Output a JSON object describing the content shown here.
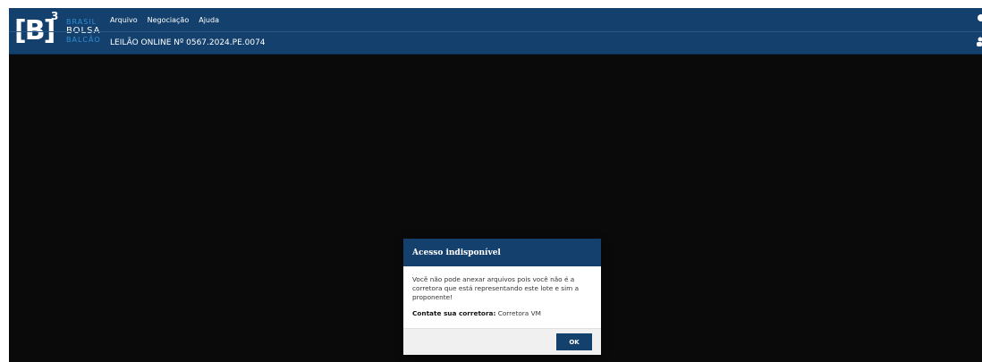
{
  "logo": {
    "mark": "[B]",
    "superscript": "3",
    "line1": "BRASIL",
    "line2": "BOLSA",
    "line3": "BALCÃO"
  },
  "menu": {
    "items": [
      "Arquivo",
      "Negociação",
      "Ajuda"
    ]
  },
  "header": {
    "auction_title": "LEILÃO ONLINE Nº 0567.2024.PE.0074"
  },
  "icons": {
    "help": "help-icon",
    "user": "user-icon"
  },
  "modal": {
    "title": "Acesso indisponível",
    "message": "Você não pode anexar arquivos pois você não é a corretora que está representando este lote e sim a proponente!",
    "contact_label": "Contate sua corretora:",
    "contact_value": "Corretora VM",
    "ok_label": "OK"
  },
  "colors": {
    "brand_navy": "#14406d",
    "accent_blue": "#2e8fd6",
    "overlay": "#0a0a0a"
  }
}
